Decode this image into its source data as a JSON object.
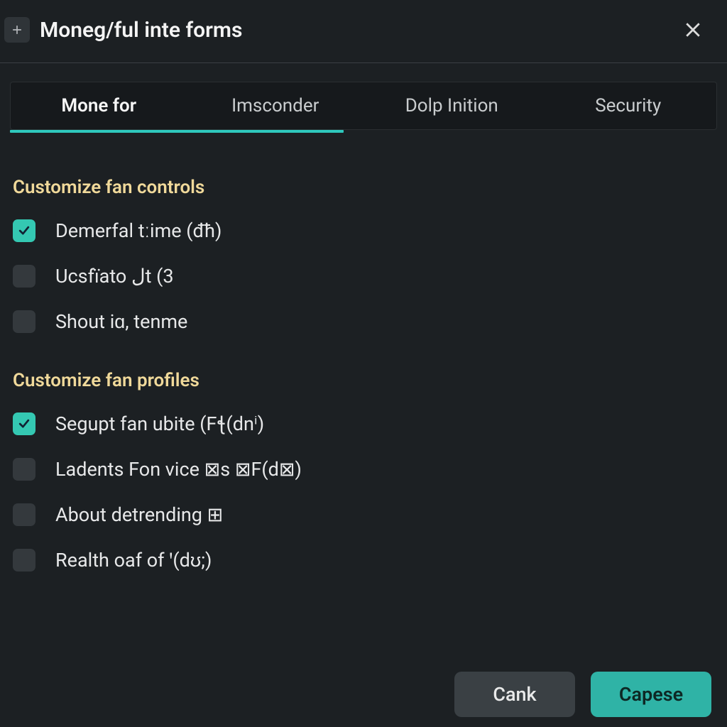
{
  "header": {
    "title": "Moneg/ful inte forms"
  },
  "tabs": [
    {
      "label": "Mone for",
      "active": true
    },
    {
      "label": "Imsconder",
      "active": false
    },
    {
      "label": "Dolp Inition",
      "active": false
    },
    {
      "label": "Security",
      "active": false
    }
  ],
  "sections": [
    {
      "title": "Customize fan controls",
      "items": [
        {
          "label": "Demerfal tːime (đħ)",
          "checked": true
        },
        {
          "label": "Ucsfïato ﻝt (3",
          "checked": false
        },
        {
          "label": "Shout iɑ, tenme",
          "checked": false
        }
      ]
    },
    {
      "title": "Customize fan profiles",
      "items": [
        {
          "label": "Segupt fan ubite (Fꞎ(dnⁱ)",
          "checked": true
        },
        {
          "label": "Ladents Fon vice ⊠s ⊠F(d⊠)",
          "checked": false
        },
        {
          "label": "About detrending ⊞",
          "checked": false
        },
        {
          "label": "Realth oaf of ꞌ(dʊ;)",
          "checked": false
        }
      ]
    }
  ],
  "footer": {
    "cancel": "Cank",
    "confirm": "Capese"
  }
}
